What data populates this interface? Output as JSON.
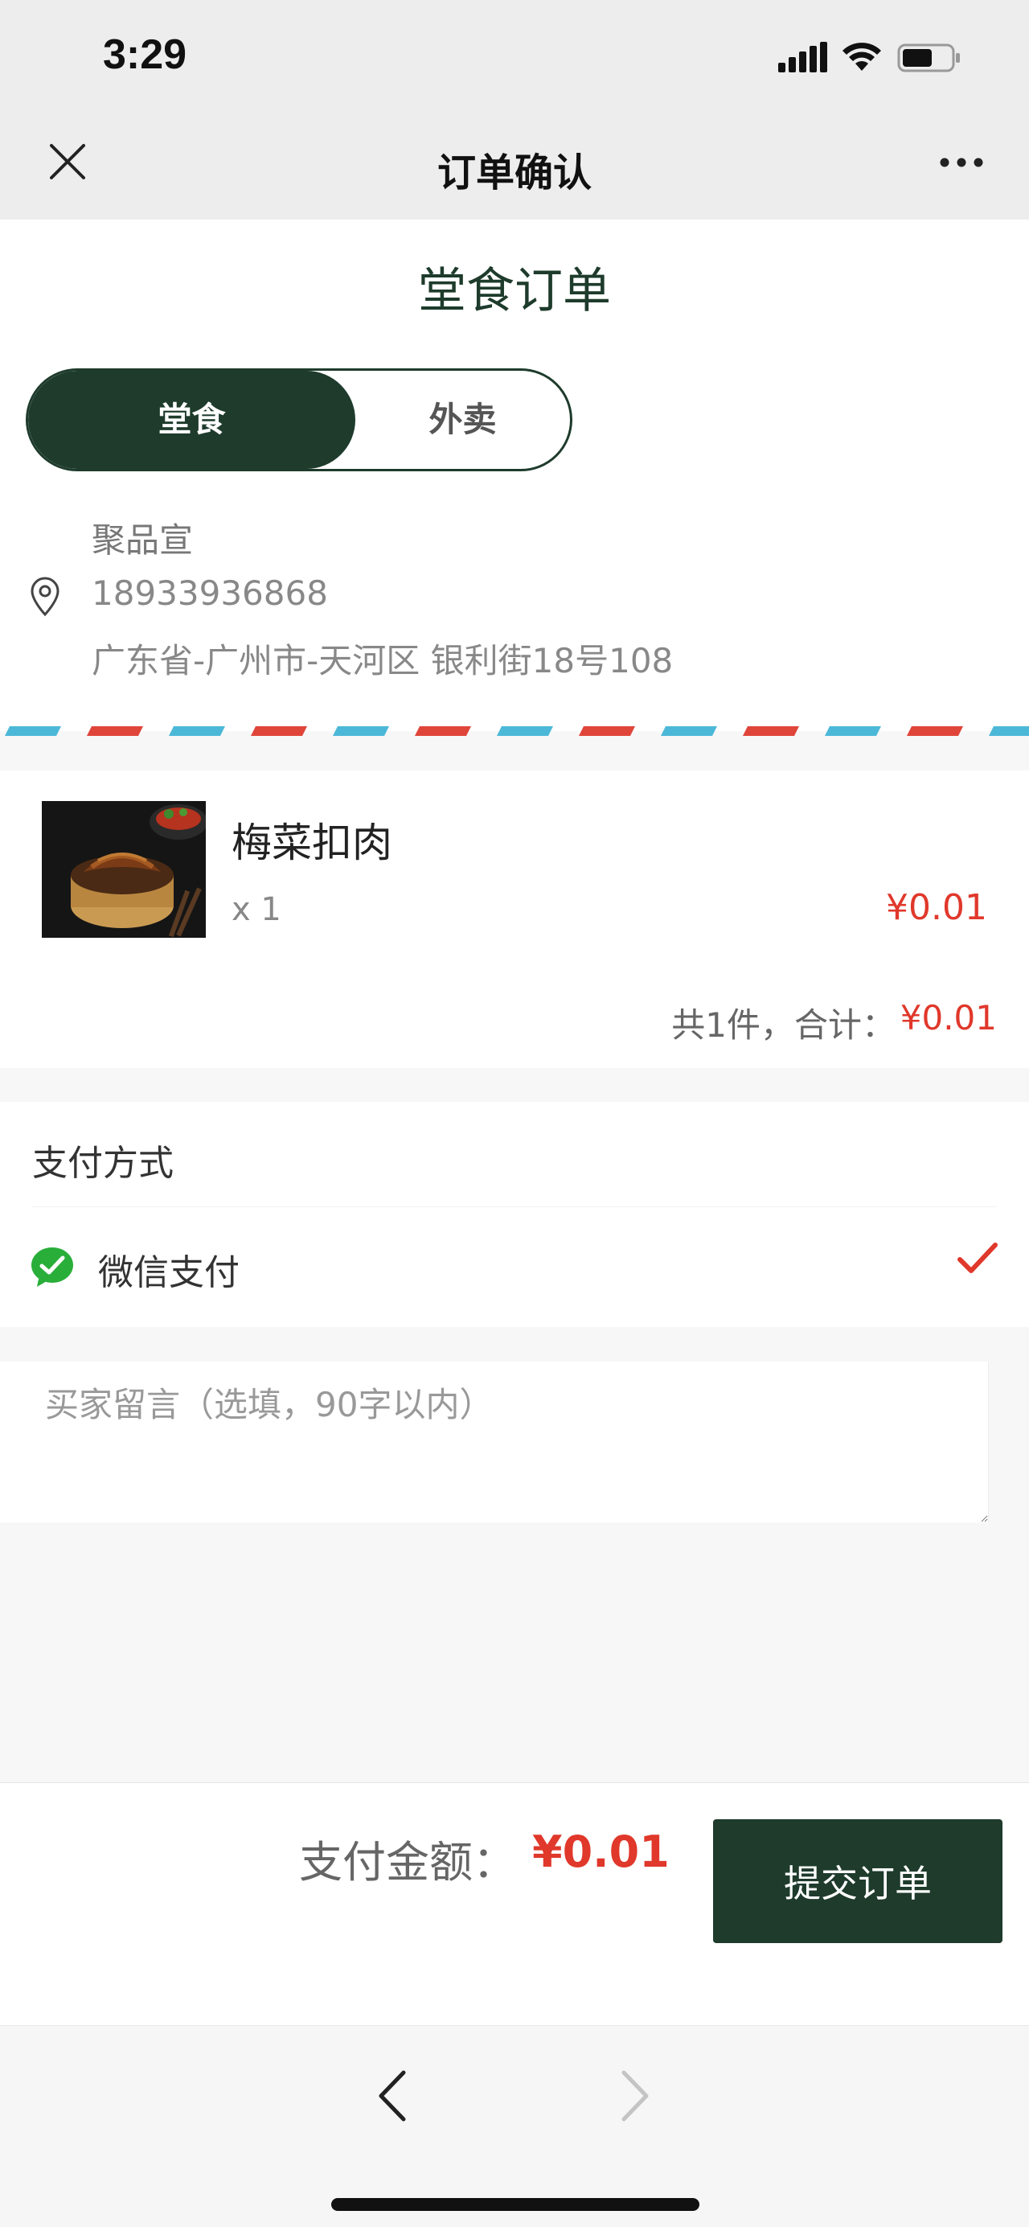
{
  "status_bar": {
    "time": "3:29"
  },
  "navbar": {
    "title": "订单确认"
  },
  "header": {
    "order_title": "堂食订单",
    "toggle": {
      "active": "堂食",
      "inactive": "外卖"
    }
  },
  "address": {
    "name": "聚品宣",
    "phone": "18933936868",
    "line": "广东省-广州市-天河区 银利街18号108"
  },
  "item": {
    "name": "梅菜扣肉",
    "qty": "x 1",
    "price": "¥0.01",
    "total_label": "共1件，合计：",
    "total_value": "¥0.01"
  },
  "payment": {
    "title": "支付方式",
    "method": "微信支付"
  },
  "message": {
    "placeholder": "买家留言（选填，90字以内）"
  },
  "bottom": {
    "amount_label": "支付金额：",
    "amount_value": "¥0.01",
    "submit_label": "提交订单"
  },
  "colors": {
    "brand_green": "#1e3b2c",
    "price_red": "#e0382b",
    "airmail_blue": "#4cb8d8",
    "airmail_red": "#e0453a"
  }
}
